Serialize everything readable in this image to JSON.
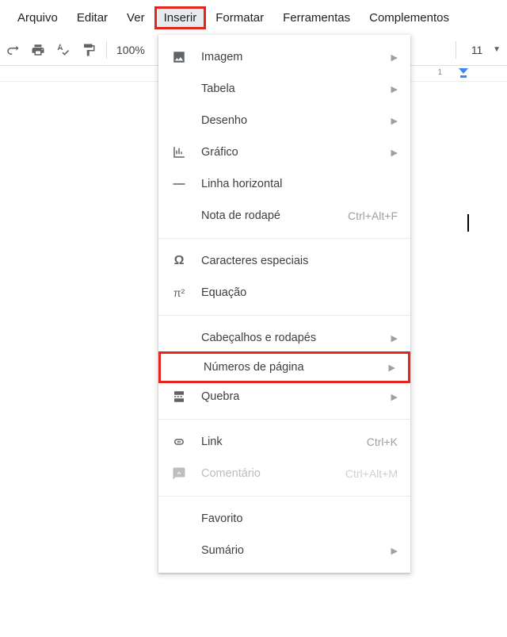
{
  "menubar": {
    "items": [
      {
        "label": "Arquivo"
      },
      {
        "label": "Editar"
      },
      {
        "label": "Ver"
      },
      {
        "label": "Inserir"
      },
      {
        "label": "Formatar"
      },
      {
        "label": "Ferramentas"
      },
      {
        "label": "Complementos"
      }
    ]
  },
  "toolbar": {
    "zoom": "100%",
    "fontsize": "11"
  },
  "ruler": {
    "mark": "1"
  },
  "dropdown": {
    "items": [
      {
        "label": "Imagem",
        "icon": "image",
        "arrow": true
      },
      {
        "label": "Tabela",
        "arrow": true
      },
      {
        "label": "Desenho",
        "arrow": true
      },
      {
        "label": "Gráfico",
        "icon": "chart",
        "arrow": true
      },
      {
        "label": "Linha horizontal",
        "icon": "hr"
      },
      {
        "label": "Nota de rodapé",
        "shortcut": "Ctrl+Alt+F"
      },
      {
        "sep": true
      },
      {
        "label": "Caracteres especiais",
        "icon": "omega"
      },
      {
        "label": "Equação",
        "icon": "pi"
      },
      {
        "sep": true
      },
      {
        "label": "Cabeçalhos e rodapés",
        "arrow": true
      },
      {
        "label": "Números de página",
        "arrow": true,
        "highlighted": true
      },
      {
        "label": "Quebra",
        "icon": "break",
        "arrow": true
      },
      {
        "sep": true
      },
      {
        "label": "Link",
        "icon": "link",
        "shortcut": "Ctrl+K"
      },
      {
        "label": "Comentário",
        "icon": "comment",
        "shortcut": "Ctrl+Alt+M",
        "disabled": true
      },
      {
        "sep": true
      },
      {
        "label": "Favorito"
      },
      {
        "label": "Sumário",
        "arrow": true
      }
    ]
  }
}
